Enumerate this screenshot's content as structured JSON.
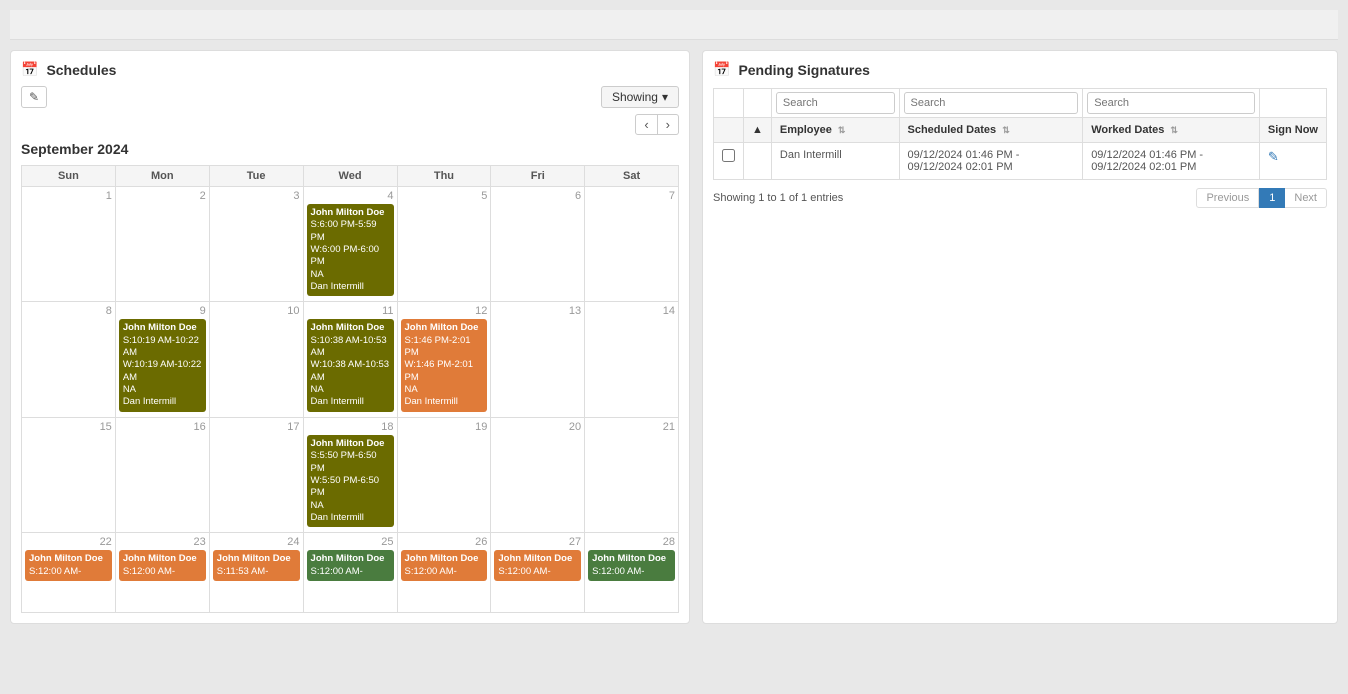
{
  "schedules": {
    "title": "Schedules",
    "showing_label": "Showing",
    "month": "September 2024",
    "edit_icon": "✎",
    "nav_prev": "‹",
    "nav_next": "›",
    "days_of_week": [
      "Sun",
      "Mon",
      "Tue",
      "Wed",
      "Thu",
      "Fri",
      "Sat"
    ],
    "calendar_rows": [
      {
        "week": 1,
        "days": [
          {
            "num": 1,
            "events": []
          },
          {
            "num": 2,
            "events": []
          },
          {
            "num": 3,
            "events": []
          },
          {
            "num": 4,
            "events": [
              {
                "color": "olive",
                "name": "John Milton Doe",
                "s": "S:6:00 PM-5:59 PM",
                "w": "W:6:00 PM-6:00 PM",
                "status": "NA",
                "person": "Dan Intermill"
              }
            ]
          },
          {
            "num": 5,
            "events": []
          },
          {
            "num": 6,
            "events": []
          },
          {
            "num": 7,
            "events": []
          }
        ]
      },
      {
        "week": 2,
        "days": [
          {
            "num": 8,
            "events": []
          },
          {
            "num": 9,
            "events": [
              {
                "color": "olive",
                "name": "John Milton Doe",
                "s": "S:10:19 AM-10:22 AM",
                "w": "W:10:19 AM-10:22 AM",
                "status": "NA",
                "person": "Dan Intermill"
              }
            ]
          },
          {
            "num": 10,
            "events": []
          },
          {
            "num": 11,
            "events": [
              {
                "color": "olive",
                "name": "John Milton Doe",
                "s": "S:10:38 AM-10:53 AM",
                "w": "W:10:38 AM-10:53 AM",
                "status": "NA",
                "person": "Dan Intermill"
              }
            ]
          },
          {
            "num": 12,
            "events": [
              {
                "color": "orange",
                "name": "John Milton Doe",
                "s": "S:1:46 PM-2:01 PM",
                "w": "W:1:46 PM-2:01 PM",
                "status": "NA",
                "person": "Dan Intermill"
              }
            ]
          },
          {
            "num": 13,
            "events": []
          },
          {
            "num": 14,
            "events": []
          }
        ]
      },
      {
        "week": 3,
        "days": [
          {
            "num": 15,
            "events": []
          },
          {
            "num": 16,
            "events": []
          },
          {
            "num": 17,
            "events": []
          },
          {
            "num": 18,
            "events": [
              {
                "color": "olive",
                "name": "John Milton Doe",
                "s": "S:5:50 PM-6:50 PM",
                "w": "W:5:50 PM-6:50 PM",
                "status": "NA",
                "person": "Dan Intermill"
              }
            ]
          },
          {
            "num": 19,
            "events": []
          },
          {
            "num": 20,
            "events": []
          },
          {
            "num": 21,
            "events": []
          }
        ]
      },
      {
        "week": 4,
        "days": [
          {
            "num": 22,
            "events": [
              {
                "color": "orange",
                "name": "John Milton Doe",
                "s": "S:12:00 AM-",
                "w": "",
                "status": "",
                "person": ""
              }
            ]
          },
          {
            "num": 23,
            "events": [
              {
                "color": "orange",
                "name": "John Milton Doe",
                "s": "S:12:00 AM-",
                "w": "",
                "status": "",
                "person": ""
              }
            ]
          },
          {
            "num": 24,
            "events": [
              {
                "color": "orange",
                "name": "John Milton Doe",
                "s": "S:11:53 AM-",
                "w": "",
                "status": "",
                "person": ""
              }
            ]
          },
          {
            "num": 25,
            "events": [
              {
                "color": "green",
                "name": "John Milton Doe",
                "s": "S:12:00 AM-",
                "w": "",
                "status": "",
                "person": ""
              }
            ]
          },
          {
            "num": 26,
            "events": [
              {
                "color": "orange",
                "name": "John Milton Doe",
                "s": "S:12:00 AM-",
                "w": "",
                "status": "",
                "person": ""
              }
            ]
          },
          {
            "num": 27,
            "events": [
              {
                "color": "orange",
                "name": "John Milton Doe",
                "s": "S:12:00 AM-",
                "w": "",
                "status": "",
                "person": ""
              }
            ]
          },
          {
            "num": 28,
            "events": [
              {
                "color": "green",
                "name": "John Milton Doe",
                "s": "S:12:00 AM-",
                "w": "",
                "status": "",
                "person": ""
              }
            ]
          }
        ]
      }
    ]
  },
  "pending_signatures": {
    "title": "Pending Signatures",
    "search_placeholders": [
      "Search",
      "Search",
      "Search"
    ],
    "columns": {
      "checkbox": "",
      "sort": "",
      "employee": "Employee",
      "scheduled_dates": "Scheduled Dates",
      "worked_dates": "Worked Dates",
      "sign_now": "Sign Now"
    },
    "rows": [
      {
        "employee": "Dan Intermill",
        "scheduled_dates": "09/12/2024 01:46 PM - 09/12/2024 02:01 PM",
        "worked_dates": "09/12/2024 01:46 PM - 09/12/2024 02:01 PM",
        "sign_now_icon": "✎"
      }
    ],
    "footer": {
      "showing_text": "Showing 1 to 1 of 1 entries",
      "pagination": {
        "previous": "Previous",
        "page1": "1",
        "next": "Next"
      }
    }
  }
}
